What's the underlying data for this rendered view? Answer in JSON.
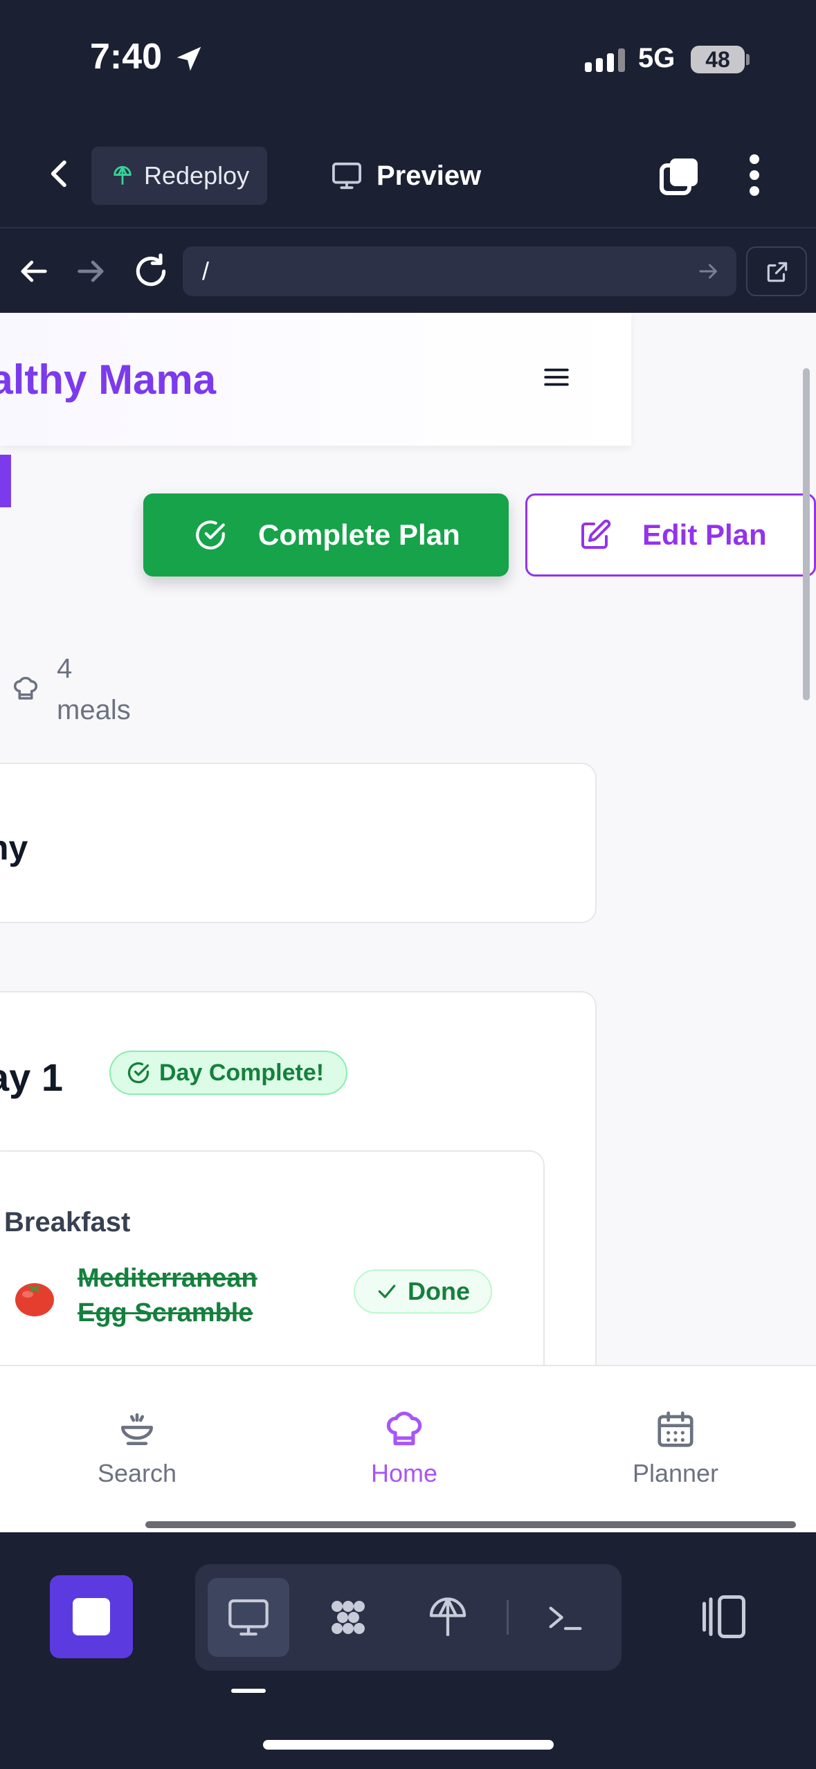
{
  "status_bar": {
    "time": "7:40",
    "network": "5G",
    "battery": "48"
  },
  "toolbar": {
    "redeploy_label": "Redeploy",
    "preview_label": "Preview"
  },
  "browser": {
    "url": "/"
  },
  "site": {
    "title": "ealthy Mama"
  },
  "actions": {
    "complete_label": "Complete Plan",
    "edit_label": "Edit Plan"
  },
  "plan": {
    "meals_count": "4",
    "meals_unit": "meals",
    "card_text": "hy"
  },
  "day": {
    "title": "ay 1",
    "status_badge": "Day Complete!",
    "meal": {
      "type": "Breakfast",
      "emoji": "🍅",
      "name": "Mediterranean Egg Scramble",
      "status": "Done"
    }
  },
  "bottom_nav": {
    "items": [
      {
        "label": "Search",
        "icon": "bowl-search-icon"
      },
      {
        "label": "Home",
        "icon": "chef-hat-icon",
        "active": true
      },
      {
        "label": "Planner",
        "icon": "calendar-icon"
      }
    ]
  },
  "colors": {
    "brand": "#7c3aed",
    "success": "#16a34a",
    "nav_active": "#a855f7",
    "ide_bg": "#1c2033"
  }
}
